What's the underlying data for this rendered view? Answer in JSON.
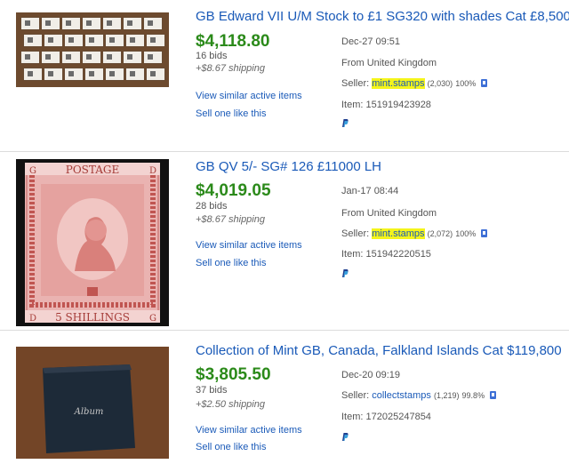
{
  "listings": [
    {
      "title": "GB Edward VII U/M Stock to £1 SG320 with shades Cat £8,500",
      "price": "$4,118.80",
      "bids": "16 bids",
      "shipping": "+$8.67 shipping",
      "view_similar": "View similar active items",
      "sell_one": "Sell one like this",
      "date": "Dec-27 09:51",
      "from": "From United Kingdom",
      "seller_label": "Seller:",
      "seller_name": "mint.stamps",
      "seller_feedback": "(2,030)",
      "seller_percent": "100%",
      "item_label": "Item:",
      "item_number": "151919423928"
    },
    {
      "title": "GB QV 5/- SG# 126 £11000 LH",
      "price": "$4,019.05",
      "bids": "28 bids",
      "shipping": "+$8.67 shipping",
      "view_similar": "View similar active items",
      "sell_one": "Sell one like this",
      "date": "Jan-17 08:44",
      "from": "From United Kingdom",
      "seller_label": "Seller:",
      "seller_name": "mint.stamps",
      "seller_feedback": "(2,072)",
      "seller_percent": "100%",
      "item_label": "Item:",
      "item_number": "151942220515",
      "stamp_text": {
        "top": "POSTAGE",
        "bottom": "5 SHILLINGS",
        "tl": "G",
        "tr": "D",
        "bl": "D",
        "br": "G"
      }
    },
    {
      "title": "Collection of Mint GB, Canada, Falkland Islands Cat $119,800",
      "price": "$3,805.50",
      "bids": "37 bids",
      "shipping": "+$2.50 shipping",
      "view_similar": "View similar active items",
      "sell_one": "Sell one like this",
      "date": "Dec-20 09:19",
      "seller_label": "Seller:",
      "seller_name": "collectstamps",
      "seller_feedback": "(1,219)",
      "seller_percent": "99.8%",
      "item_label": "Item:",
      "item_number": "172025247854",
      "album_text": "Album"
    }
  ],
  "colors": {
    "link": "#1a5ab8",
    "price": "#2b8a1a",
    "highlight": "#f5f51a"
  },
  "icons": [
    "top-rated-seller-icon",
    "paypal-icon"
  ]
}
